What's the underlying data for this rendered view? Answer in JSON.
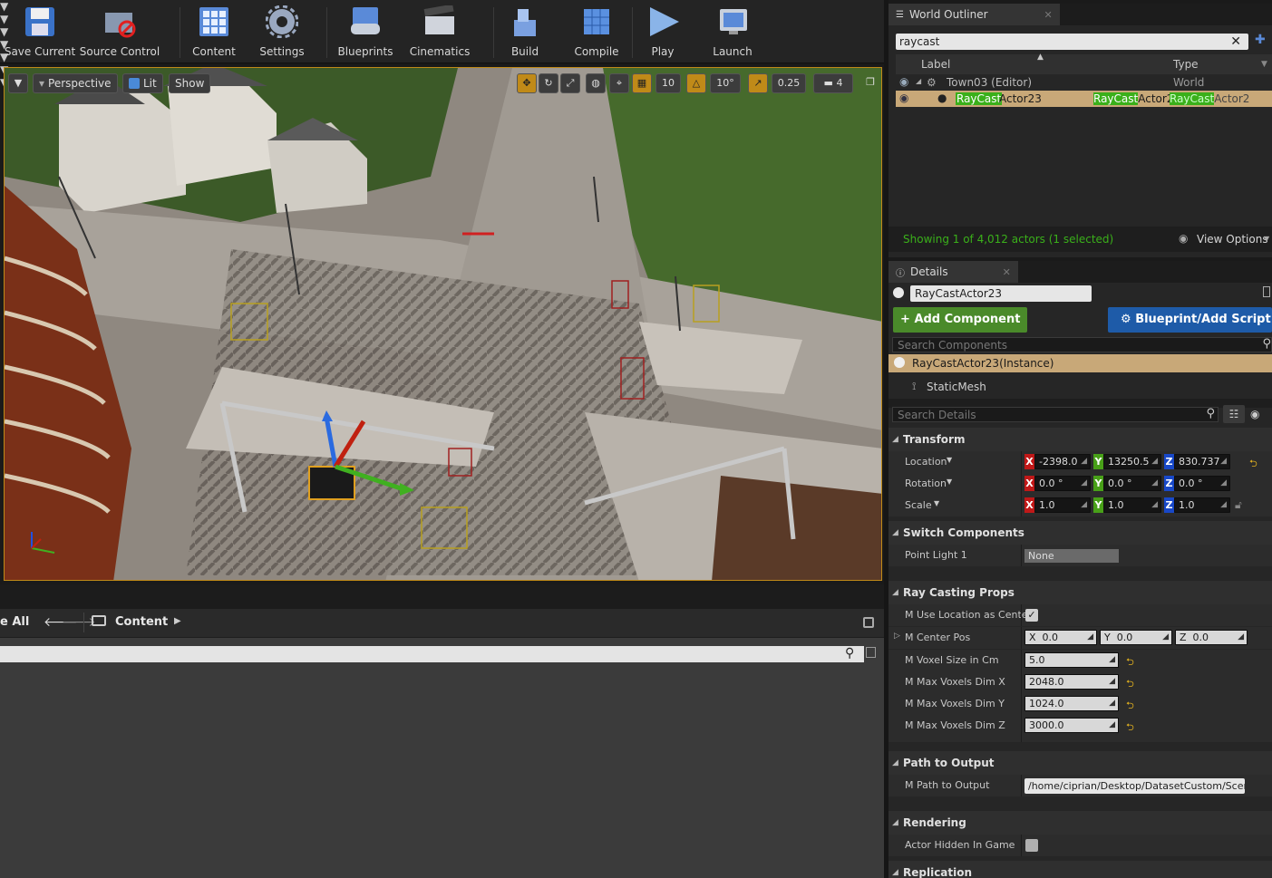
{
  "toolbar": {
    "buttons": [
      {
        "label": "Save Current",
        "icon": "floppy-disk-icon"
      },
      {
        "label": "Source Control",
        "icon": "source-control-icon"
      },
      {
        "label": "Content",
        "icon": "content-grid-icon"
      },
      {
        "label": "Settings",
        "icon": "settings-gear-icon"
      },
      {
        "label": "Blueprints",
        "icon": "blueprints-icon"
      },
      {
        "label": "Cinematics",
        "icon": "clapperboard-icon"
      },
      {
        "label": "Build",
        "icon": "build-blocks-icon"
      },
      {
        "label": "Compile",
        "icon": "compile-cube-icon"
      },
      {
        "label": "Play",
        "icon": "play-icon"
      },
      {
        "label": "Launch",
        "icon": "launch-icon"
      }
    ]
  },
  "viewport": {
    "perspective_label": "Perspective",
    "lit_label": "Lit",
    "show_label": "Show",
    "grid_snap_value": "10",
    "rotation_snap_value": "10°",
    "scale_snap_value": "0.25",
    "camera_speed_value": "4"
  },
  "content_browser": {
    "save_all_label": "e All",
    "path_root": "Content"
  },
  "outliner": {
    "tab_title": "World Outliner",
    "search_value": "raycast",
    "col_label": "Label",
    "col_type": "Type",
    "rows": [
      {
        "label": "Town03 (Editor)",
        "type": "World"
      },
      {
        "label_match": "RayCast",
        "label_rest": "Actor23",
        "type_part1": "RayCastActor2",
        "type_part2_match": "RayCast",
        "type_part2_rest": "Actor2"
      }
    ],
    "status_text": "Showing 1 of 4,012 actors (1 selected)",
    "view_options_label": "View Options"
  },
  "details": {
    "tab_title": "Details",
    "actor_name": "RayCastActor23",
    "add_component_label": "Add Component",
    "blueprint_label": "Blueprint/Add Script",
    "search_components_placeholder": "Search Components",
    "instance_label": "RayCastActor23(Instance)",
    "static_mesh_label": "StaticMesh",
    "search_details_placeholder": "Search Details",
    "transform": {
      "title": "Transform",
      "location_label": "Location",
      "rotation_label": "Rotation",
      "scale_label": "Scale",
      "location": [
        "-2398.0",
        "13250.5",
        "830.737"
      ],
      "rotation": [
        "0.0 °",
        "0.0 °",
        "0.0 °"
      ],
      "scale": [
        "1.0",
        "1.0",
        "1.0"
      ]
    },
    "switch_components": {
      "title": "Switch Components",
      "point_light_label": "Point Light 1",
      "point_light_value": "None"
    },
    "ray_casting": {
      "title": "Ray Casting Props",
      "use_location_label": "M Use Location as Center",
      "center_pos_label": "M Center Pos",
      "center_pos": [
        "0.0",
        "0.0",
        "0.0"
      ],
      "voxel_size_label": "M Voxel Size in Cm",
      "voxel_size": "5.0",
      "max_x_label": "M Max Voxels Dim X",
      "max_x": "2048.0",
      "max_y_label": "M Max Voxels Dim Y",
      "max_y": "1024.0",
      "max_z_label": "M Max Voxels Dim Z",
      "max_z": "3000.0"
    },
    "path_output": {
      "title": "Path to Output",
      "label": "M Path to Output",
      "value": "/home/ciprian/Desktop/DatasetCustom/Scene"
    },
    "rendering": {
      "title": "Rendering",
      "hidden_label": "Actor Hidden In Game"
    },
    "replication": {
      "title": "Replication"
    },
    "axes": [
      "X",
      "Y",
      "Z"
    ]
  },
  "colors": {
    "accent_orange": "#c08a18",
    "selected_row": "#c8a878",
    "green_button": "#4a8a2a",
    "blue_button": "#1e5ba8",
    "axis_x": "#c01818",
    "axis_y": "#48a018",
    "axis_z": "#1848c8"
  }
}
